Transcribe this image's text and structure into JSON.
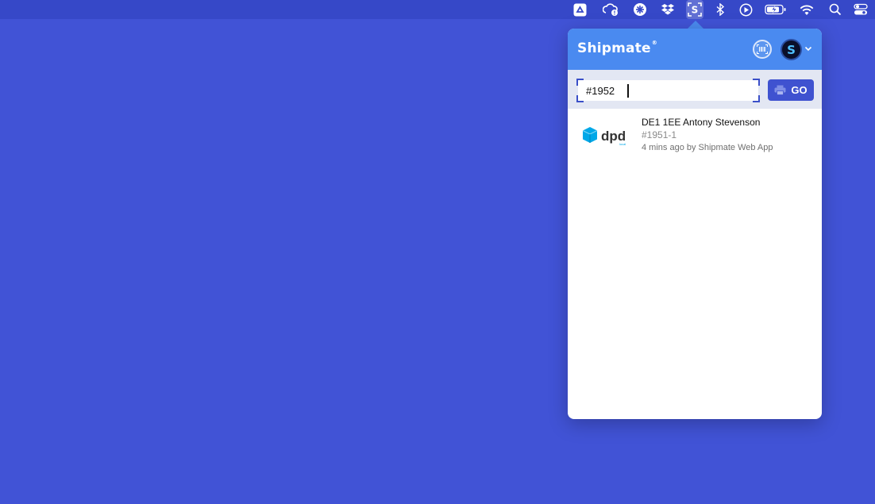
{
  "menubar": {
    "icons": [
      "google-drive-icon",
      "cloud-upload-icon",
      "perplexity-icon",
      "dropbox-icon",
      "shipmate-icon",
      "bluetooth-icon",
      "play-icon",
      "battery-icon",
      "wifi-icon",
      "spotlight-search-icon",
      "control-center-icon"
    ]
  },
  "popover": {
    "brand": "Shipmate",
    "brand_mark": "®",
    "avatar_letter": "S",
    "search": {
      "value": "#1952",
      "button_label": "GO"
    },
    "shipments": [
      {
        "carrier": "dpd",
        "carrier_sub": "local",
        "title": "DE1 1EE Antony Stevenson",
        "reference": "#1951-1",
        "meta": "4 mins ago by Shipmate Web App"
      }
    ]
  },
  "colors": {
    "desktop": "#4153d6",
    "header": "#4a8af0",
    "go_button": "#3f52d0",
    "dpd_cube": "#00a8e8"
  }
}
